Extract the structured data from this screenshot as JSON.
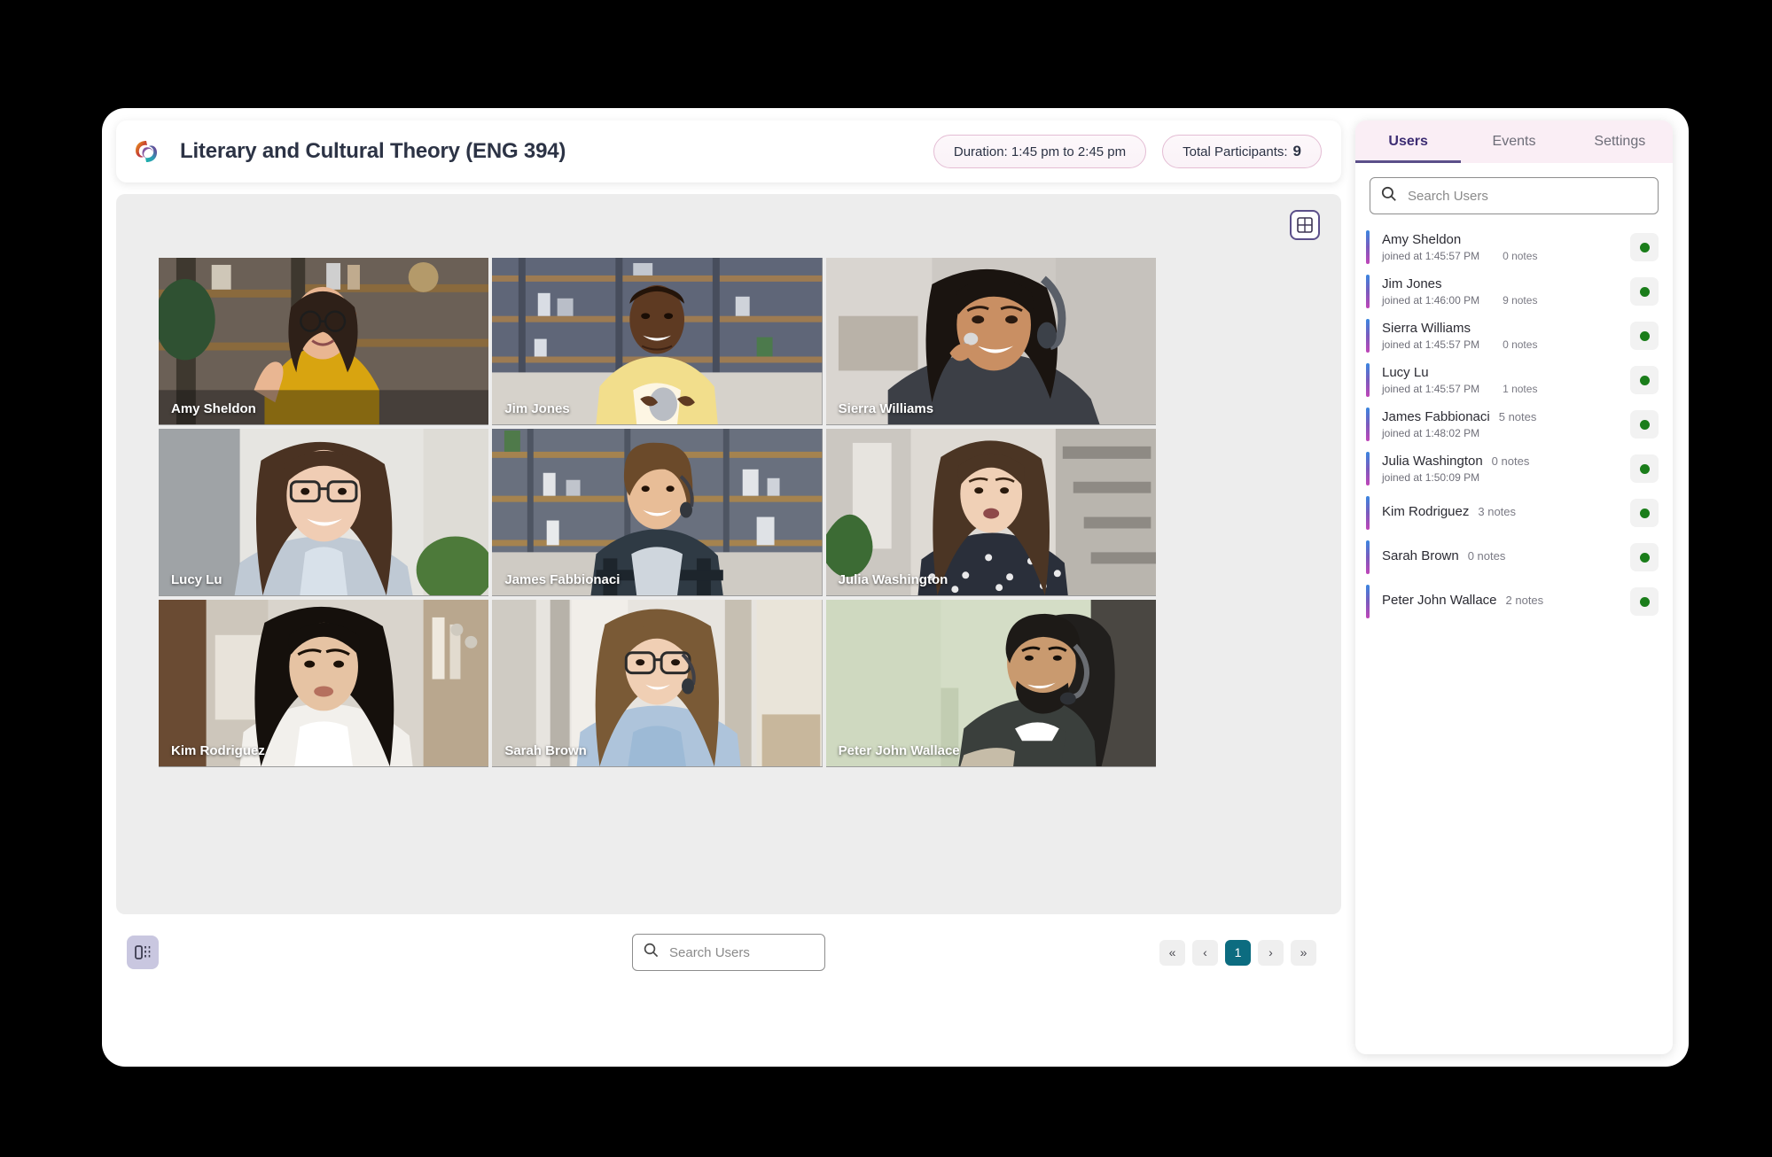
{
  "header": {
    "title": "Literary and Cultural Theory (ENG 394)",
    "logo_icon": "spiral-logo-icon",
    "duration_badge": "Duration: 1:45 pm to 2:45 pm",
    "participants_label": "Total Participants:",
    "participants_count": "9"
  },
  "stage": {
    "grid_layout_icon": "grid-layout-icon",
    "tiles": [
      {
        "name": "Amy Sheldon"
      },
      {
        "name": "Jim Jones"
      },
      {
        "name": "Sierra Williams"
      },
      {
        "name": "Lucy Lu"
      },
      {
        "name": "James Fabbionaci"
      },
      {
        "name": "Julia Washington"
      },
      {
        "name": "Kim Rodriguez"
      },
      {
        "name": "Sarah Brown"
      },
      {
        "name": "Peter John Wallace"
      }
    ]
  },
  "footer": {
    "panel_toggle_icon": "collapse-sidebar-icon",
    "search": {
      "icon": "search-icon",
      "placeholder": "Search Users",
      "value": ""
    },
    "pagination": {
      "first_label": "«",
      "prev_label": "‹",
      "pages": [
        "1"
      ],
      "next_label": "›",
      "last_label": "»",
      "active_page": "1"
    }
  },
  "sidebar": {
    "tabs": [
      {
        "label": "Users",
        "active": true
      },
      {
        "label": "Events",
        "active": false
      },
      {
        "label": "Settings",
        "active": false
      }
    ],
    "search": {
      "icon": "search-icon",
      "placeholder": "Search Users",
      "value": ""
    },
    "users": [
      {
        "name": "Amy Sheldon",
        "joined": "joined at 1:45:57 PM",
        "notes": "0  notes",
        "notes_inline": "",
        "status": "online"
      },
      {
        "name": "Jim Jones",
        "joined": "joined at 1:46:00 PM",
        "notes": "9  notes",
        "notes_inline": "",
        "status": "online"
      },
      {
        "name": "Sierra Williams",
        "joined": "joined at 1:45:57 PM",
        "notes": "0  notes",
        "notes_inline": "",
        "status": "online"
      },
      {
        "name": "Lucy Lu",
        "joined": "joined at 1:45:57 PM",
        "notes": "1  notes",
        "notes_inline": "",
        "status": "online"
      },
      {
        "name": "James Fabbionaci",
        "joined": "joined at  1:48:02 PM",
        "notes": "",
        "notes_inline": "5 notes",
        "status": "online"
      },
      {
        "name": "Julia Washington",
        "joined": "joined at  1:50:09 PM",
        "notes": "",
        "notes_inline": "0  notes",
        "status": "online"
      },
      {
        "name": "Kim  Rodriguez",
        "joined": "",
        "notes": "",
        "notes_inline": "3 notes",
        "status": "online"
      },
      {
        "name": " Sarah Brown",
        "joined": "",
        "notes": "",
        "notes_inline": "0 notes",
        "status": "online"
      },
      {
        "name": "Peter John Wallace",
        "joined": "",
        "notes": "",
        "notes_inline": "2  notes",
        "status": "online"
      }
    ]
  },
  "colors": {
    "accent_purple": "#5b4f8a",
    "tab_bg": "#faeef5",
    "active_page": "#0c6c80",
    "status_online": "#1a7d1a",
    "stage_bg": "#ededed"
  }
}
